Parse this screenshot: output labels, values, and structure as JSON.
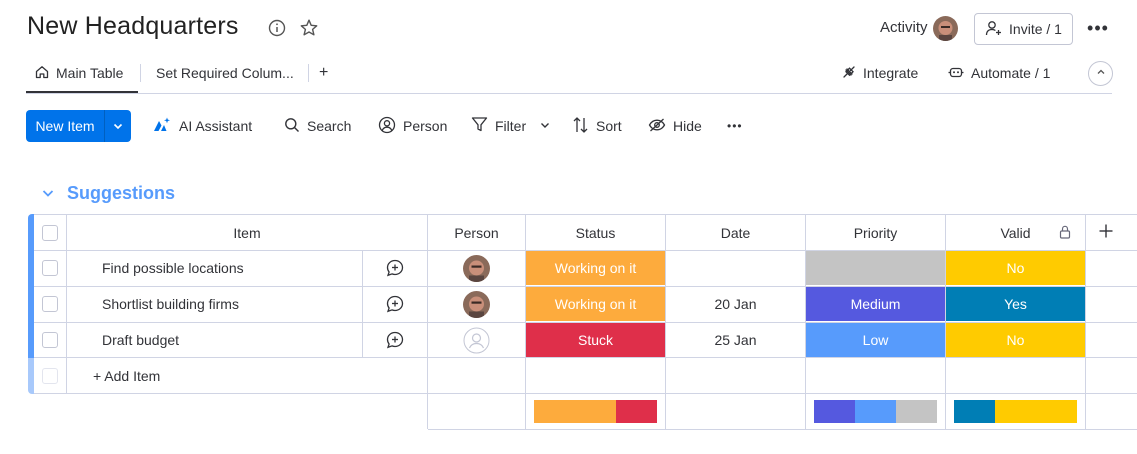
{
  "board": {
    "title": "New Headquarters"
  },
  "header": {
    "activity_label": "Activity",
    "invite_label": "Invite / 1"
  },
  "tabs": [
    {
      "label": "Main Table",
      "icon": "home-icon",
      "active": true
    },
    {
      "label": "Set Required Colum...",
      "active": false
    }
  ],
  "tab_add_label": "+",
  "integrations": {
    "integrate_label": "Integrate",
    "automate_label": "Automate / 1"
  },
  "toolbar": {
    "new_item_label": "New Item",
    "ai_assistant_label": "AI Assistant",
    "search_label": "Search",
    "person_label": "Person",
    "filter_label": "Filter",
    "sort_label": "Sort",
    "hide_label": "Hide"
  },
  "group": {
    "title": "Suggestions",
    "color": "#579bfc"
  },
  "columns": {
    "item": "Item",
    "person": "Person",
    "status": "Status",
    "date": "Date",
    "priority": "Priority",
    "valid": "Valid"
  },
  "rows": [
    {
      "name": "Find possible locations",
      "person": "avatar",
      "status": {
        "label": "Working on it",
        "color": "#fdab3d"
      },
      "date": "",
      "priority": {
        "label": "",
        "color": "#c4c4c4"
      },
      "valid": {
        "label": "No",
        "color": "#ffcb00"
      }
    },
    {
      "name": "Shortlist building firms",
      "person": "avatar",
      "status": {
        "label": "Working on it",
        "color": "#fdab3d"
      },
      "date": "20 Jan",
      "priority": {
        "label": "Medium",
        "color": "#5559df"
      },
      "valid": {
        "label": "Yes",
        "color": "#007eb5"
      }
    },
    {
      "name": "Draft budget",
      "person": "empty",
      "status": {
        "label": "Stuck",
        "color": "#df2f4a"
      },
      "date": "25 Jan",
      "priority": {
        "label": "Low",
        "color": "#579bfc"
      },
      "valid": {
        "label": "No",
        "color": "#ffcb00"
      }
    }
  ],
  "add_item_label": "+ Add Item",
  "summary": {
    "status": [
      {
        "color": "#fdab3d",
        "fraction": 0.667
      },
      {
        "color": "#df2f4a",
        "fraction": 0.333
      }
    ],
    "priority": [
      {
        "color": "#5559df",
        "fraction": 0.333
      },
      {
        "color": "#579bfc",
        "fraction": 0.333
      },
      {
        "color": "#c4c4c4",
        "fraction": 0.334
      }
    ],
    "valid": [
      {
        "color": "#007eb5",
        "fraction": 0.333
      },
      {
        "color": "#ffcb00",
        "fraction": 0.667
      }
    ]
  }
}
